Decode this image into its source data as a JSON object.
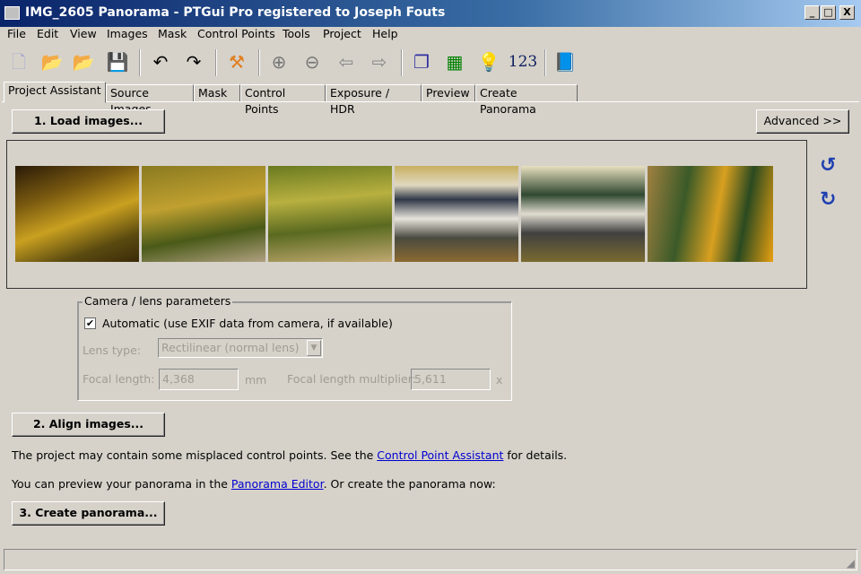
{
  "window": {
    "title": "IMG_2605 Panorama - PTGui Pro registered to Joseph Fouts",
    "minimize": "_",
    "maximize": "□",
    "close": "X"
  },
  "menu": [
    "File",
    "Edit",
    "View",
    "Images",
    "Mask",
    "Control Points",
    "Tools",
    "Project",
    "Help"
  ],
  "toolbar": {
    "numbers_label": "123"
  },
  "tabs": [
    "Project Assistant",
    "Source Images",
    "Mask",
    "Control Points",
    "Exposure / HDR",
    "Preview",
    "Create Panorama"
  ],
  "assistant": {
    "load_button": "1. Load images...",
    "advanced_button": "Advanced >>",
    "camera_group": {
      "title": "Camera / lens parameters",
      "automatic_label": "Automatic (use EXIF data from camera, if available)",
      "automatic_checked": true,
      "lens_type_label": "Lens type:",
      "lens_type_value": "Rectilinear (normal lens)",
      "focal_length_label": "Focal length:",
      "focal_length_value": "4,368",
      "focal_length_unit": "mm",
      "multiplier_label": "Focal length multiplier:",
      "multiplier_value": "5,611",
      "multiplier_unit": "x"
    },
    "align_button": "2. Align images...",
    "msg1_pre": "The project may contain some misplaced control points. See the ",
    "msg1_link": "Control Point Assistant",
    "msg1_post": " for details.",
    "msg2_pre": "You can preview your panorama in the ",
    "msg2_link": "Panorama Editor",
    "msg2_post": ". Or create the panorama now:",
    "create_button": "3. Create panorama..."
  }
}
